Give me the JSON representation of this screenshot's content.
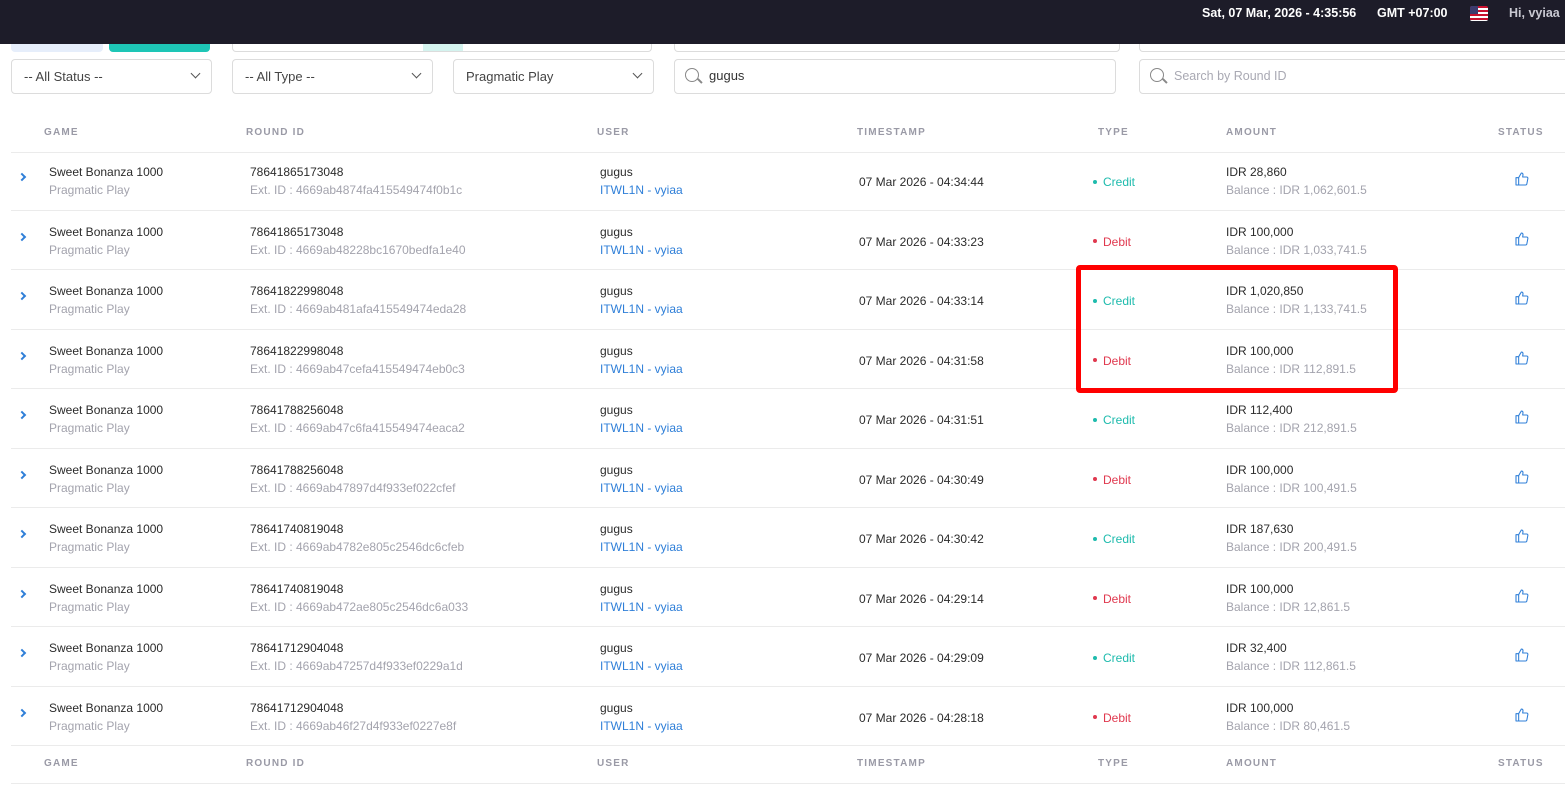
{
  "topbar": {
    "datetime": "Sat, 07 Mar, 2026 - 4:35:56",
    "timezone": "GMT +07:00",
    "flag_icon": "us-flag-icon",
    "greeting": "Hi, vyiaa"
  },
  "filters": {
    "status": "-- All Status --",
    "type": "-- All Type --",
    "provider": "Pragmatic Play",
    "user_search": "gugus",
    "round_search_placeholder": "Search by Round ID"
  },
  "columns": {
    "game": "GAME",
    "round_id": "ROUND ID",
    "user": "USER",
    "timestamp": "TIMESTAMP",
    "type": "TYPE",
    "amount": "AMOUNT",
    "status": "STATUS"
  },
  "rows": [
    {
      "game": "Sweet Bonanza 1000",
      "provider": "Pragmatic Play",
      "round_id": "78641865173048",
      "ext_id": "Ext. ID : 4669ab4874fa415549474f0b1c",
      "user": "gugus",
      "agent": "ITWL1N - vyiaa",
      "timestamp": "07 Mar 2026 - 04:34:44",
      "type": "Credit",
      "amount": "IDR 28,860",
      "balance": "Balance : IDR 1,062,601.5"
    },
    {
      "game": "Sweet Bonanza 1000",
      "provider": "Pragmatic Play",
      "round_id": "78641865173048",
      "ext_id": "Ext. ID : 4669ab48228bc1670bedfa1e40",
      "user": "gugus",
      "agent": "ITWL1N - vyiaa",
      "timestamp": "07 Mar 2026 - 04:33:23",
      "type": "Debit",
      "amount": "IDR 100,000",
      "balance": "Balance : IDR 1,033,741.5"
    },
    {
      "game": "Sweet Bonanza 1000",
      "provider": "Pragmatic Play",
      "round_id": "78641822998048",
      "ext_id": "Ext. ID : 4669ab481afa415549474eda28",
      "user": "gugus",
      "agent": "ITWL1N - vyiaa",
      "timestamp": "07 Mar 2026 - 04:33:14",
      "type": "Credit",
      "amount": "IDR 1,020,850",
      "balance": "Balance : IDR 1,133,741.5"
    },
    {
      "game": "Sweet Bonanza 1000",
      "provider": "Pragmatic Play",
      "round_id": "78641822998048",
      "ext_id": "Ext. ID : 4669ab47cefa415549474eb0c3",
      "user": "gugus",
      "agent": "ITWL1N - vyiaa",
      "timestamp": "07 Mar 2026 - 04:31:58",
      "type": "Debit",
      "amount": "IDR 100,000",
      "balance": "Balance : IDR 112,891.5"
    },
    {
      "game": "Sweet Bonanza 1000",
      "provider": "Pragmatic Play",
      "round_id": "78641788256048",
      "ext_id": "Ext. ID : 4669ab47c6fa415549474eaca2",
      "user": "gugus",
      "agent": "ITWL1N - vyiaa",
      "timestamp": "07 Mar 2026 - 04:31:51",
      "type": "Credit",
      "amount": "IDR 112,400",
      "balance": "Balance : IDR 212,891.5"
    },
    {
      "game": "Sweet Bonanza 1000",
      "provider": "Pragmatic Play",
      "round_id": "78641788256048",
      "ext_id": "Ext. ID : 4669ab47897d4f933ef022cfef",
      "user": "gugus",
      "agent": "ITWL1N - vyiaa",
      "timestamp": "07 Mar 2026 - 04:30:49",
      "type": "Debit",
      "amount": "IDR 100,000",
      "balance": "Balance : IDR 100,491.5"
    },
    {
      "game": "Sweet Bonanza 1000",
      "provider": "Pragmatic Play",
      "round_id": "78641740819048",
      "ext_id": "Ext. ID : 4669ab4782e805c2546dc6cfeb",
      "user": "gugus",
      "agent": "ITWL1N - vyiaa",
      "timestamp": "07 Mar 2026 - 04:30:42",
      "type": "Credit",
      "amount": "IDR 187,630",
      "balance": "Balance : IDR 200,491.5"
    },
    {
      "game": "Sweet Bonanza 1000",
      "provider": "Pragmatic Play",
      "round_id": "78641740819048",
      "ext_id": "Ext. ID : 4669ab472ae805c2546dc6a033",
      "user": "gugus",
      "agent": "ITWL1N - vyiaa",
      "timestamp": "07 Mar 2026 - 04:29:14",
      "type": "Debit",
      "amount": "IDR 100,000",
      "balance": "Balance : IDR 12,861.5"
    },
    {
      "game": "Sweet Bonanza 1000",
      "provider": "Pragmatic Play",
      "round_id": "78641712904048",
      "ext_id": "Ext. ID : 4669ab47257d4f933ef0229a1d",
      "user": "gugus",
      "agent": "ITWL1N - vyiaa",
      "timestamp": "07 Mar 2026 - 04:29:09",
      "type": "Credit",
      "amount": "IDR 32,400",
      "balance": "Balance : IDR 112,861.5"
    },
    {
      "game": "Sweet Bonanza 1000",
      "provider": "Pragmatic Play",
      "round_id": "78641712904048",
      "ext_id": "Ext. ID : 4669ab46f27d4f933ef0227e8f",
      "user": "gugus",
      "agent": "ITWL1N - vyiaa",
      "timestamp": "07 Mar 2026 - 04:28:18",
      "type": "Debit",
      "amount": "IDR 100,000",
      "balance": "Balance : IDR 80,461.5"
    }
  ],
  "icons": {
    "expand": "chevron-right-icon",
    "status": "thumbs-up-icon",
    "search": "search-icon",
    "dropdown": "chevron-down-icon"
  },
  "colors": {
    "topbar": "#1d1c29",
    "credit": "#1ebbad",
    "debit": "#e0384e",
    "link": "#2f7fd8",
    "highlight": "#ff0000"
  }
}
